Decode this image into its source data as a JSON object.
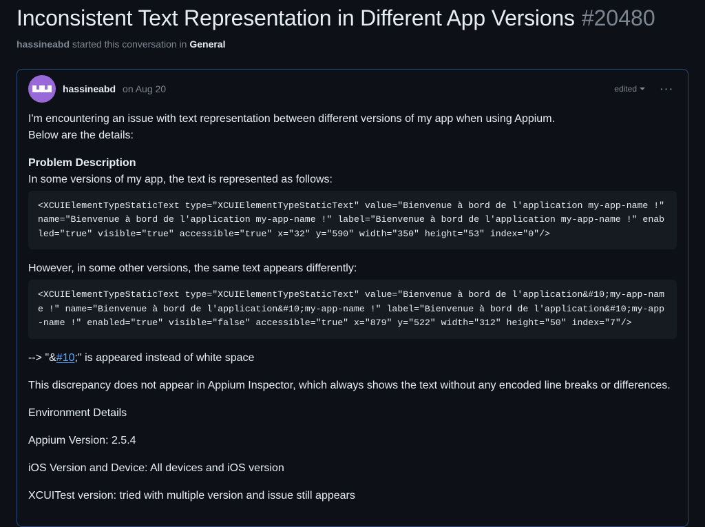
{
  "header": {
    "title": "Inconsistent Text Representation in Different App Versions",
    "number": "#20480"
  },
  "subheader": {
    "author": "hassineabd",
    "mid": " started this conversation in ",
    "category": "General"
  },
  "comment": {
    "author": "hassineabd",
    "date": "on Aug 20",
    "edited_label": "edited",
    "body": {
      "intro1": "I'm encountering an issue with text representation between different versions of my app when using Appium.",
      "intro2": "Below are the details:",
      "problem_heading": "Problem Description",
      "problem_line": "In some versions of my app, the text is represented as follows:",
      "code1": "<XCUIElementTypeStaticText type=\"XCUIElementTypeStaticText\" value=\"Bienvenue à bord de l'application my-app-name !\" name=\"Bienvenue à bord de l'application my-app-name !\" label=\"Bienvenue à bord de l'application my-app-name !\" enabled=\"true\" visible=\"true\" accessible=\"true\" x=\"32\" y=\"590\" width=\"350\" height=\"53\" index=\"0\"/>",
      "however_line": "However, in some other versions, the same text appears differently:",
      "code2": "<XCUIElementTypeStaticText type=\"XCUIElementTypeStaticText\" value=\"Bienvenue à bord de l'application&#10;my-app-name !\" name=\"Bienvenue à bord de l'application&#10;my-app-name !\" label=\"Bienvenue à bord de l'application&#10;my-app-name !\" enabled=\"true\" visible=\"false\" accessible=\"true\" x=\"879\" y=\"522\" width=\"312\" height=\"50\" index=\"7\"/>",
      "arrow_prefix": "--> \"&",
      "link_text": "#10",
      "arrow_suffix": ";\" is appeared instead of white space",
      "discrepancy": "This discrepancy does not appear in Appium Inspector, which always shows the text without any encoded line breaks or differences.",
      "env_heading": "Environment Details",
      "env1": "Appium Version: 2.5.4",
      "env2": "iOS Version and Device: All devices and iOS version",
      "env3": "XCUITest version: tried with multiple version and issue still appears"
    }
  }
}
